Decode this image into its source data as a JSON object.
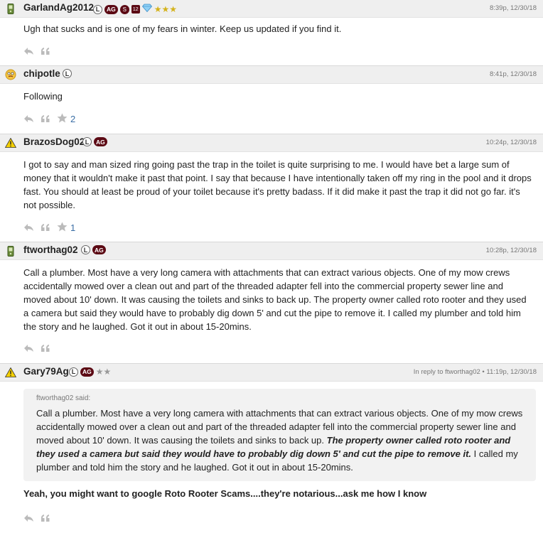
{
  "posts": [
    {
      "username": "GarlandAg2012",
      "badge_l": "L",
      "badge_ag": "AG",
      "mini_badge_1": "S",
      "mini_badge_2": "12",
      "stars": "★★★",
      "timestamp": "8:39p, 12/30/18",
      "text": "Ugh that sucks and is one of my fears in winter. Keep us updated if you find it.",
      "likes": ""
    },
    {
      "username": "chipotle",
      "badge_l": "L",
      "timestamp": "8:41p, 12/30/18",
      "text": "Following",
      "likes": "2"
    },
    {
      "username": "BrazosDog02",
      "badge_l": "L",
      "badge_ag": "AG",
      "timestamp": "10:24p, 12/30/18",
      "text": "I got to say and man sized ring going past the trap in the toilet is quite surprising to me. I would have bet a large sum of money that it wouldn't make it past that point. I say that because I have intentionally taken off my ring in the pool and it drops fast. You should at least be proud of your toilet because it's pretty badass. If it did make it past the trap it did not go far. it's not possible.",
      "likes": "1"
    },
    {
      "username": "ftworthag02",
      "badge_l": "L",
      "badge_ag": "AG",
      "timestamp": "10:28p, 12/30/18",
      "text": "Call a plumber. Most have a very long camera with attachments that can extract various objects. One of my mow crews accidentally mowed over a clean out and part of the threaded adapter fell into the commercial property sewer line and moved about 10' down. It was causing the toilets and sinks to back up. The property owner called roto rooter and they used a camera but said they would have to probably dig down 5' and cut the pipe to remove it. I called my plumber and told him the story and he laughed. Got it out in about 15-20mins.",
      "likes": ""
    },
    {
      "username": "Gary79Ag",
      "badge_l": "L",
      "badge_ag": "AG",
      "stars": "★★",
      "timestamp": "In reply to ftworthag02 • 11:19p, 12/30/18",
      "quote_attr": "ftworthag02 said:",
      "quote_plain_1": "Call a plumber. Most have a very long camera with attachments that can extract various objects. One of my mow crews accidentally mowed over a clean out and part of the threaded adapter fell into the commercial property sewer line and moved about 10' down. It was causing the toilets and sinks to back up. ",
      "quote_bold": "The property owner called roto rooter and they used a camera but said they would have to probably dig down 5' and cut the pipe to remove it.",
      "quote_plain_2": " I called my plumber and told him the story and he laughed. Got it out in about 15-20mins.",
      "text": "Yeah, you might want to google Roto Rooter Scams....they're notarious...ask me how I know"
    }
  ],
  "icons": {
    "reply": "reply-icon",
    "quote": "quote-icon",
    "star": "star-icon",
    "phone": "phone-icon",
    "emoji": "emoji-icon",
    "warning": "warning-icon",
    "diamond": "diamond-icon"
  },
  "colors": {
    "header_bg": "#efefef",
    "ag_badge": "#5c0a14",
    "gold_star": "#d4b21a",
    "like_count": "#3a6ea5"
  }
}
